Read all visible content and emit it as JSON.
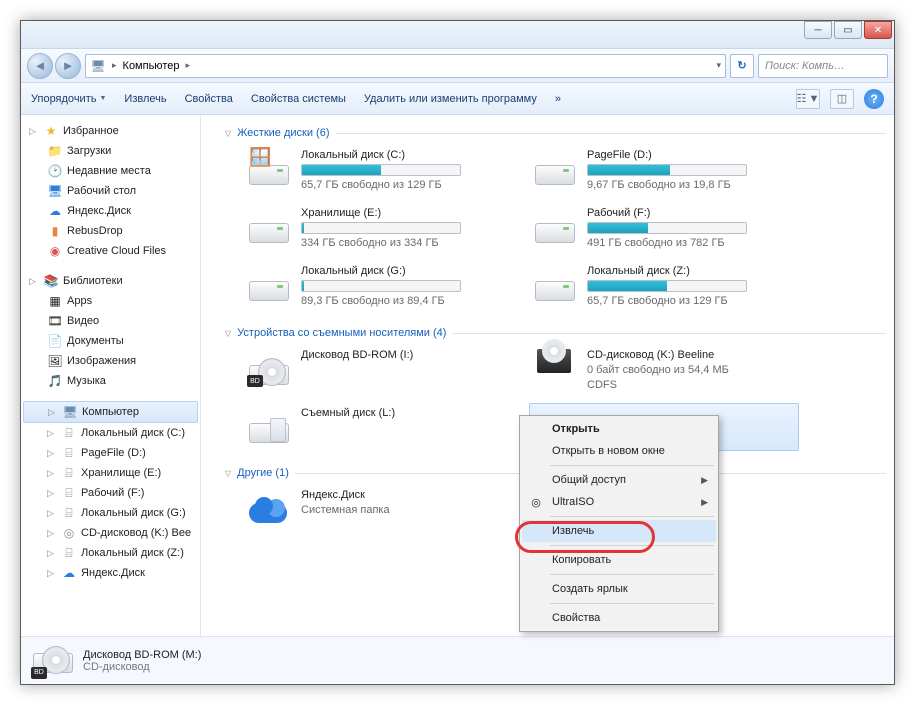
{
  "window": {
    "title": "Компьютер"
  },
  "nav": {
    "location": "Компьютер",
    "search_placeholder": "Поиск: Компь…"
  },
  "toolbar": {
    "organize": "Упорядочить",
    "eject": "Извлечь",
    "properties": "Свойства",
    "system_properties": "Свойства системы",
    "uninstall": "Удалить или изменить программу",
    "more": "»"
  },
  "sidebar": {
    "favorites": "Избранное",
    "fav_items": [
      "Загрузки",
      "Недавние места",
      "Рабочий стол",
      "Яндекс.Диск",
      "RebusDrop",
      "Creative Cloud Files"
    ],
    "libraries": "Библиотеки",
    "lib_items": [
      "Apps",
      "Видео",
      "Документы",
      "Изображения",
      "Музыка"
    ],
    "computer": "Компьютер",
    "drives": [
      "Локальный диск (C:)",
      "PageFile (D:)",
      "Хранилище (E:)",
      "Рабочий (F:)",
      "Локальный диск (G:)",
      "CD-дисковод (K:) Bee",
      "Локальный диск (Z:)",
      "Яндекс.Диск"
    ]
  },
  "groups": {
    "hdd": {
      "title": "Жесткие диски (6)"
    },
    "removable": {
      "title": "Устройства со съемными носителями (4)"
    },
    "other": {
      "title": "Другие (1)"
    }
  },
  "drives": {
    "c": {
      "name": "Локальный диск (C:)",
      "sub": "65,7 ГБ свободно из 129 ГБ",
      "fill": 50
    },
    "d": {
      "name": "PageFile (D:)",
      "sub": "9,67 ГБ свободно из 19,8 ГБ",
      "fill": 52
    },
    "e": {
      "name": "Хранилище (E:)",
      "sub": "334 ГБ свободно из 334 ГБ",
      "fill": 1
    },
    "f": {
      "name": "Рабочий (F:)",
      "sub": "491 ГБ свободно из 782 ГБ",
      "fill": 38
    },
    "g": {
      "name": "Локальный диск (G:)",
      "sub": "89,3 ГБ свободно из 89,4 ГБ",
      "fill": 1
    },
    "z": {
      "name": "Локальный диск (Z:)",
      "sub": "65,7 ГБ свободно из 129 ГБ",
      "fill": 50
    },
    "i": {
      "name": "Дисковод BD-ROM (I:)"
    },
    "k": {
      "name": "CD-дисковод (K:) Beeline",
      "sub": "0 байт свободно из 54,4 МБ",
      "fs": "CDFS"
    },
    "l": {
      "name": "Съемный диск (L:)"
    },
    "m_sel": {
      "name": ""
    },
    "yadisk": {
      "name": "Яндекс.Диск",
      "sub": "Системная папка"
    }
  },
  "context": {
    "open": "Открыть",
    "open_new": "Открыть в новом окне",
    "share": "Общий доступ",
    "ultraiso": "UltraISO",
    "eject": "Извлечь",
    "copy": "Копировать",
    "shortcut": "Создать ярлык",
    "properties": "Свойства"
  },
  "status": {
    "name": "Дисковод BD-ROM (M:)",
    "type": "CD-дисковод"
  }
}
